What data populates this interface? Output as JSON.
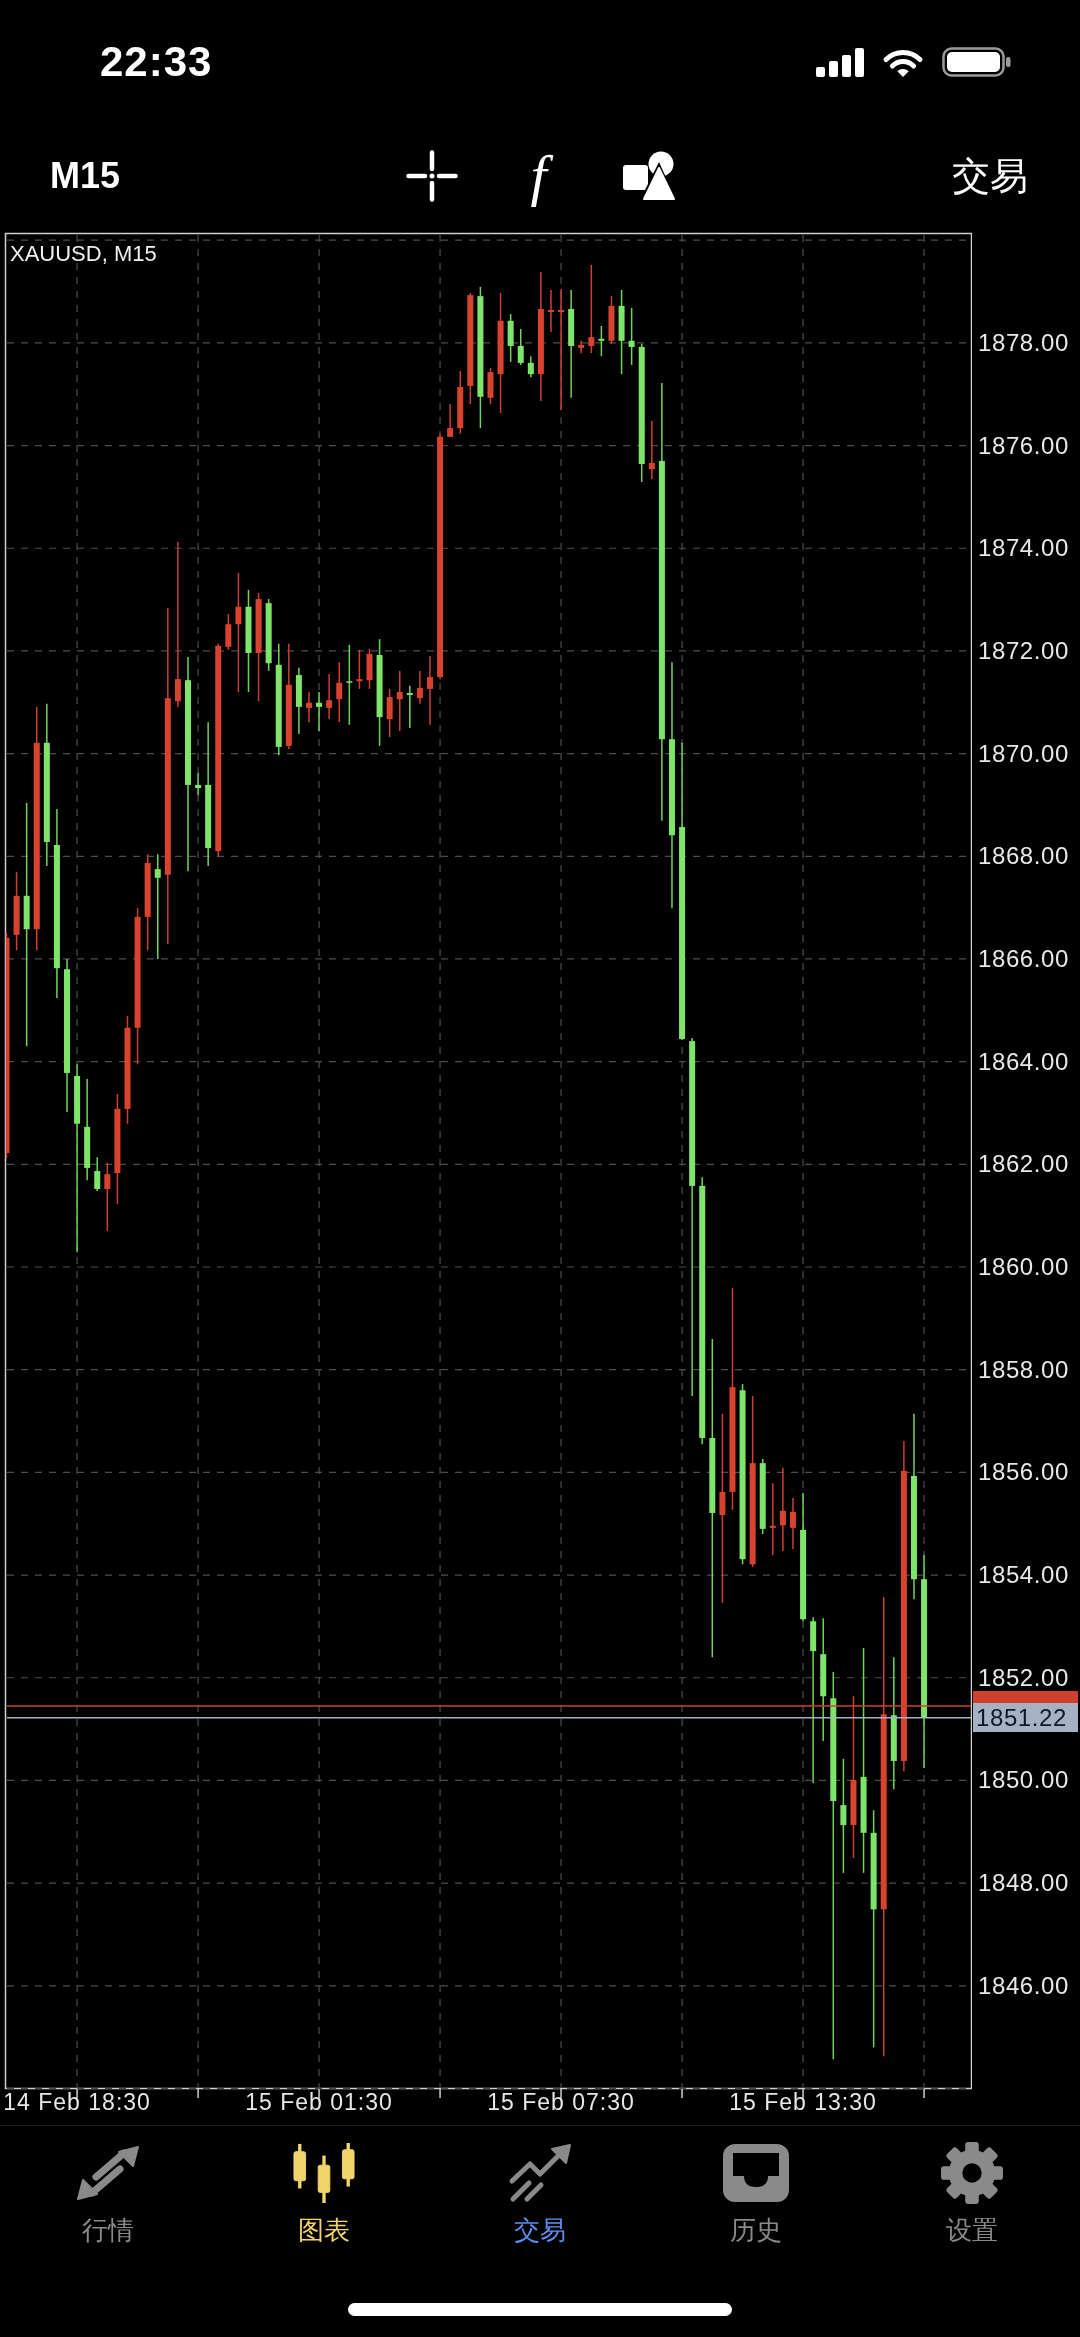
{
  "status_bar": {
    "time": "22:33"
  },
  "toolbar": {
    "timeframe": "M15",
    "indicator_glyph": "f",
    "trade_button": "交易"
  },
  "chart": {
    "chart_data": {
      "type": "candlestick",
      "title": "XAUUSD, M15",
      "categories": [
        null,
        null,
        null,
        null,
        null,
        null,
        null,
        "14 Feb 18:30",
        null,
        null,
        null,
        null,
        null,
        null,
        null,
        null,
        null,
        null,
        null,
        null,
        null,
        null,
        null,
        null,
        null,
        null,
        null,
        null,
        null,
        null,
        null,
        "15 Feb 01:30",
        null,
        null,
        null,
        null,
        null,
        null,
        null,
        null,
        null,
        null,
        null,
        null,
        null,
        null,
        null,
        null,
        null,
        null,
        null,
        null,
        null,
        null,
        null,
        "15 Feb 07:30",
        null,
        null,
        null,
        null,
        null,
        null,
        null,
        null,
        null,
        null,
        null,
        null,
        null,
        null,
        null,
        null,
        null,
        null,
        null,
        null,
        null,
        null,
        null,
        "15 Feb 13:30",
        null,
        null,
        null,
        null,
        null,
        null,
        null,
        null,
        null,
        null,
        null,
        null
      ],
      "ohlc": [
        [
          1862.22,
          1866.51,
          1862.12,
          1866.41
        ],
        [
          1866.47,
          1867.69,
          1866.17,
          1867.23
        ],
        [
          1867.23,
          1869.04,
          1864.3,
          1866.58
        ],
        [
          1866.58,
          1870.91,
          1866.17,
          1870.21
        ],
        [
          1870.21,
          1870.97,
          1867.81,
          1868.28
        ],
        [
          1868.22,
          1868.92,
          1865.24,
          1865.82
        ],
        [
          1865.8,
          1866.0,
          1863.02,
          1863.78
        ],
        [
          1863.72,
          1863.95,
          1860.29,
          1862.79
        ],
        [
          1862.73,
          1863.66,
          1861.69,
          1861.93
        ],
        [
          1861.87,
          1862.14,
          1861.48,
          1861.52
        ],
        [
          1861.52,
          1862.03,
          1860.7,
          1861.81
        ],
        [
          1861.83,
          1863.37,
          1861.23,
          1863.08
        ],
        [
          1863.08,
          1864.89,
          1862.79,
          1864.66
        ],
        [
          1864.66,
          1866.99,
          1863.95,
          1866.82
        ],
        [
          1866.82,
          1868.04,
          1866.17,
          1867.87
        ],
        [
          1867.75,
          1868.04,
          1866.0,
          1867.58
        ],
        [
          1867.64,
          1872.84,
          1866.29,
          1871.08
        ],
        [
          1871.02,
          1874.12,
          1870.91,
          1871.45
        ],
        [
          1871.43,
          1871.88,
          1867.71,
          1869.39
        ],
        [
          1869.39,
          1869.62,
          1869.19,
          1869.33
        ],
        [
          1869.39,
          1870.61,
          1867.81,
          1868.16
        ],
        [
          1868.1,
          1872.14,
          1867.99,
          1872.1
        ],
        [
          1872.08,
          1872.72,
          1872.02,
          1872.52
        ],
        [
          1872.52,
          1873.52,
          1871.2,
          1872.86
        ],
        [
          1872.86,
          1873.19,
          1871.2,
          1871.96
        ],
        [
          1871.96,
          1873.13,
          1871.02,
          1873.01
        ],
        [
          1872.93,
          1873.01,
          1871.61,
          1871.76
        ],
        [
          1871.73,
          1872.14,
          1869.97,
          1870.13
        ],
        [
          1870.15,
          1872.14,
          1870.09,
          1871.34
        ],
        [
          1871.53,
          1871.67,
          1870.38,
          1870.91
        ],
        [
          1870.89,
          1871.2,
          1870.61,
          1870.99
        ],
        [
          1870.99,
          1871.2,
          1870.44,
          1870.91
        ],
        [
          1870.89,
          1871.55,
          1870.67,
          1871.04
        ],
        [
          1871.06,
          1871.78,
          1870.61,
          1871.38
        ],
        [
          1871.41,
          1872.12,
          1870.56,
          1871.38
        ],
        [
          1871.41,
          1872.02,
          1871.26,
          1871.45
        ],
        [
          1871.43,
          1872.04,
          1871.26,
          1871.94
        ],
        [
          1871.92,
          1872.23,
          1870.15,
          1870.71
        ],
        [
          1870.67,
          1871.26,
          1870.32,
          1871.1
        ],
        [
          1871.06,
          1871.61,
          1870.44,
          1871.2
        ],
        [
          1871.18,
          1871.32,
          1870.5,
          1871.14
        ],
        [
          1871.08,
          1871.61,
          1870.97,
          1871.28
        ],
        [
          1871.26,
          1871.9,
          1870.56,
          1871.49
        ],
        [
          1871.49,
          1876.23,
          1871.45,
          1876.17
        ],
        [
          1876.17,
          1876.81,
          1876.17,
          1876.34
        ],
        [
          1876.34,
          1877.45,
          1876.23,
          1877.14
        ],
        [
          1877.16,
          1878.97,
          1876.81,
          1878.93
        ],
        [
          1878.91,
          1879.09,
          1876.34,
          1876.95
        ],
        [
          1876.93,
          1877.51,
          1876.81,
          1877.43
        ],
        [
          1877.39,
          1878.97,
          1876.63,
          1878.43
        ],
        [
          1878.43,
          1878.56,
          1877.63,
          1877.94
        ],
        [
          1877.94,
          1878.27,
          1877.57,
          1877.61
        ],
        [
          1877.61,
          1877.74,
          1877.33,
          1877.39
        ],
        [
          1877.39,
          1879.38,
          1876.87,
          1878.66
        ],
        [
          1878.6,
          1879.03,
          1878.21,
          1878.64
        ],
        [
          1878.6,
          1879.05,
          1876.69,
          1878.64
        ],
        [
          1878.66,
          1879.03,
          1876.93,
          1877.94
        ],
        [
          1877.9,
          1878.04,
          1877.8,
          1877.96
        ],
        [
          1877.94,
          1879.52,
          1877.8,
          1878.11
        ],
        [
          1878.08,
          1878.33,
          1877.74,
          1878.04
        ],
        [
          1878.04,
          1878.91,
          1877.98,
          1878.72
        ],
        [
          1878.72,
          1879.03,
          1877.39,
          1878.04
        ],
        [
          1878.04,
          1878.68,
          1877.57,
          1877.92
        ],
        [
          1877.92,
          1877.98,
          1875.29,
          1875.64
        ],
        [
          1875.54,
          1876.48,
          1875.35,
          1875.66
        ],
        [
          1875.7,
          1877.22,
          1868.69,
          1870.28
        ],
        [
          1870.28,
          1871.78,
          1866.99,
          1868.41
        ],
        [
          1868.57,
          1870.21,
          1864.42,
          1864.44
        ],
        [
          1864.4,
          1864.46,
          1857.49,
          1861.58
        ],
        [
          1861.58,
          1861.75,
          1856.55,
          1856.67
        ],
        [
          1856.67,
          1858.6,
          1852.4,
          1855.21
        ],
        [
          1855.17,
          1857.14,
          1853.46,
          1855.62
        ],
        [
          1855.62,
          1859.59,
          1855.27,
          1857.66
        ],
        [
          1857.6,
          1857.72,
          1854.21,
          1854.31
        ],
        [
          1854.21,
          1857.49,
          1854.16,
          1856.18
        ],
        [
          1856.18,
          1856.26,
          1854.8,
          1854.9
        ],
        [
          1854.92,
          1855.79,
          1854.39,
          1854.96
        ],
        [
          1854.97,
          1856.09,
          1854.47,
          1855.25
        ],
        [
          1854.92,
          1855.5,
          1854.51,
          1855.23
        ],
        [
          1854.88,
          1855.6,
          1853.1,
          1853.14
        ],
        [
          1853.1,
          1853.18,
          1849.95,
          1852.52
        ],
        [
          1852.46,
          1853.16,
          1850.77,
          1851.64
        ],
        [
          1851.6,
          1852.11,
          1844.57,
          1849.6
        ],
        [
          1849.52,
          1850.42,
          1848.2,
          1849.13
        ],
        [
          1849.13,
          1851.64,
          1848.49,
          1850.01
        ],
        [
          1850.07,
          1852.58,
          1848.2,
          1848.98
        ],
        [
          1848.98,
          1849.42,
          1844.8,
          1847.49
        ],
        [
          1847.49,
          1853.57,
          1844.63,
          1851.29
        ],
        [
          1851.27,
          1852.4,
          1849.83,
          1850.38
        ],
        [
          1850.38,
          1856.61,
          1850.18,
          1856.03
        ],
        [
          1855.93,
          1857.14,
          1853.53,
          1853.92
        ],
        [
          1853.92,
          1854.39,
          1850.24,
          1851.22
        ]
      ],
      "ylim": [
        1844,
        1880.13
      ],
      "yticks": [
        {
          "value": 1878,
          "label": "1878.00"
        },
        {
          "value": 1876,
          "label": "1876.00"
        },
        {
          "value": 1874,
          "label": "1874.00"
        },
        {
          "value": 1872,
          "label": "1872.00"
        },
        {
          "value": 1870,
          "label": "1870.00"
        },
        {
          "value": 1868,
          "label": "1868.00"
        },
        {
          "value": 1866,
          "label": "1866.00"
        },
        {
          "value": 1864,
          "label": "1864.00"
        },
        {
          "value": 1862,
          "label": "1862.00"
        },
        {
          "value": 1860,
          "label": "1860.00"
        },
        {
          "value": 1858,
          "label": "1858.00"
        },
        {
          "value": 1856,
          "label": "1856.00"
        },
        {
          "value": 1854,
          "label": "1854.00"
        },
        {
          "value": 1852,
          "label": "1852.00"
        },
        {
          "value": 1850,
          "label": "1850.00"
        },
        {
          "value": 1848,
          "label": "1848.00"
        },
        {
          "value": 1846,
          "label": "1846.00"
        }
      ],
      "ref_lines": [
        {
          "axis": "y",
          "value": 1851.45,
          "color": "#d0402f"
        },
        {
          "axis": "y",
          "value": 1851.22,
          "color": "#a6b2c4",
          "label": "1851.22"
        }
      ]
    }
  },
  "tabs": [
    {
      "label": "行情",
      "selected": false,
      "highlighted": false
    },
    {
      "label": "图表",
      "selected": true,
      "highlighted": false
    },
    {
      "label": "交易",
      "selected": false,
      "highlighted": true
    },
    {
      "label": "历史",
      "selected": false,
      "highlighted": false
    },
    {
      "label": "设置",
      "selected": false,
      "highlighted": false
    }
  ]
}
